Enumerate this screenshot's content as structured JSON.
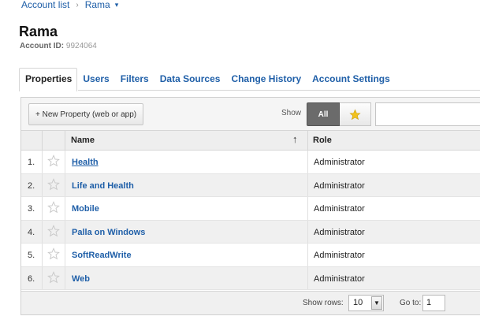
{
  "breadcrumb": {
    "account_list": "Account list",
    "separator": "›",
    "current": "Rama",
    "caret": "▾"
  },
  "account": {
    "name": "Rama",
    "id_label": "Account ID:",
    "id_value": "9924064"
  },
  "tabs": [
    {
      "label": "Properties",
      "active": true
    },
    {
      "label": "Users"
    },
    {
      "label": "Filters"
    },
    {
      "label": "Data Sources"
    },
    {
      "label": "Change History"
    },
    {
      "label": "Account Settings"
    }
  ],
  "toolbar": {
    "new_property_label": "+ New Property (web or app)",
    "show_label": "Show",
    "all_label": "All",
    "star_filter_icon": "star-icon",
    "search_value": ""
  },
  "table": {
    "columns": {
      "name": "Name",
      "sort_indicator": "↑",
      "role": "Role"
    },
    "rows": [
      {
        "index": "1.",
        "name": "Health",
        "role": "Administrator"
      },
      {
        "index": "2.",
        "name": "Life and Health",
        "role": "Administrator"
      },
      {
        "index": "3.",
        "name": "Mobile",
        "role": "Administrator"
      },
      {
        "index": "4.",
        "name": "Palla on Windows",
        "role": "Administrator"
      },
      {
        "index": "5.",
        "name": "SoftReadWrite",
        "role": "Administrator"
      },
      {
        "index": "6.",
        "name": "Web",
        "role": "Administrator"
      }
    ]
  },
  "footer": {
    "show_rows_label": "Show rows:",
    "rows_value": "10",
    "goto_label": "Go to:",
    "goto_value": "1"
  },
  "colors": {
    "link": "#1f5fa8",
    "all_button_bg": "#6b6b6b",
    "star_active": "#f2c21c",
    "star_outline": "#c8c8c8"
  }
}
